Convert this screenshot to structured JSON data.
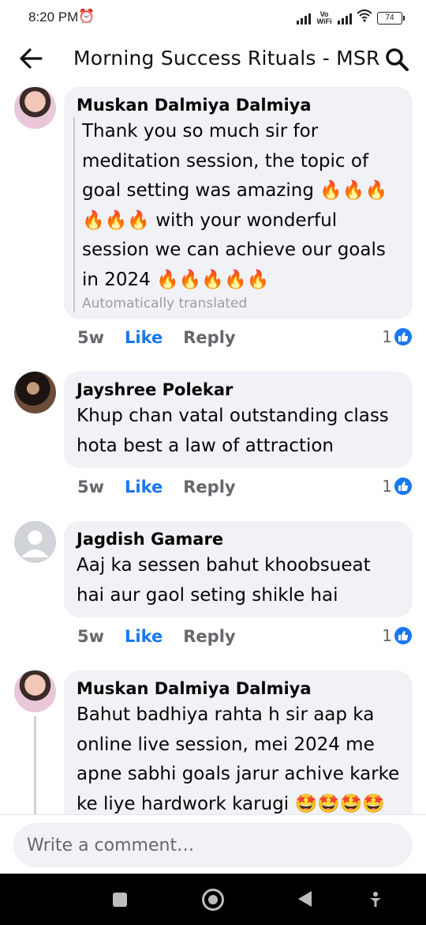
{
  "status": {
    "time": "8:20 PM",
    "alarm_icon": "alarm-clock-icon",
    "network_label": "Vo WiFi",
    "battery": "74"
  },
  "header": {
    "title": "Morning Success Rituals - MSR"
  },
  "comments": [
    {
      "author": "Muskan Dalmiya Dalmiya",
      "text": "Thank you so much sir for meditation session, the topic of goal setting was amazing 🔥🔥🔥🔥🔥🔥 with your wonderful session we can achieve our goals in 2024 🔥🔥🔥🔥🔥",
      "translated_label": "Automatically translated",
      "time": "5w",
      "like": "Like",
      "reply": "Reply",
      "reactions": "1"
    },
    {
      "author": "Jayshree Polekar",
      "text": "Khup chan vatal outstanding class hota best a law of attraction",
      "time": "5w",
      "like": "Like",
      "reply": "Reply",
      "reactions": "1"
    },
    {
      "author": "Jagdish Gamare",
      "text": "Aaj ka sessen bahut khoobsueat hai aur gaol seting shikle hai",
      "time": "5w",
      "like": "Like",
      "reply": "Reply",
      "reactions": "1"
    },
    {
      "author": "Muskan Dalmiya Dalmiya",
      "text": "Bahut badhiya rahta h sir aap ka online live session, mei 2024  me apne sabhi goals jarur achive karke ke liye hardwork karugi 🤩🤩🤩🤩"
    }
  ],
  "compose": {
    "placeholder": "Write a comment…"
  },
  "colors": {
    "accent": "#1877f2",
    "bubble": "#f0f2f5",
    "muted": "#65676b"
  }
}
